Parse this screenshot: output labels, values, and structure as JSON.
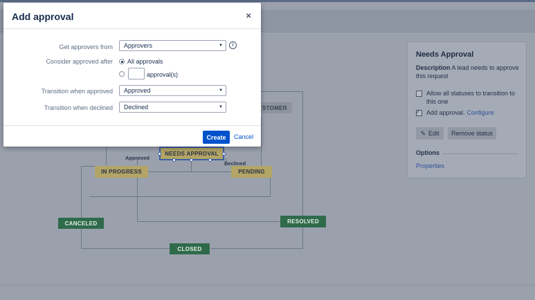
{
  "workflow": {
    "nodes": {
      "needs_approval": "NEEDS APPROVAL",
      "in_progress": "IN PROGRESS",
      "pending": "PENDING",
      "customer": "STOMER",
      "canceled": "CANCELED",
      "resolved": "RESOLVED",
      "closed": "CLOSED"
    },
    "labels": {
      "approved": "Approved",
      "declined": "Declined"
    }
  },
  "panel": {
    "title": "Needs Approval",
    "description_label": "Description",
    "description_text": "A lead needs to approve this request",
    "allow_all_statuses": "Allow all statuses to transition to this one",
    "add_approval": "Add approval.",
    "configure_link": "Configure",
    "edit_button": "Edit",
    "remove_button": "Remove status",
    "options_heading": "Options",
    "properties_link": "Properties"
  },
  "dialog": {
    "title": "Add approval",
    "close_glyph": "×",
    "approvers_from_label": "Get approvers from",
    "approvers_from_value": "Approvers",
    "consider_approved_label": "Consider approved after",
    "all_approvals_label": "All approvals",
    "approvals_suffix": "approval(s)",
    "approvals_count_value": "",
    "transition_approved_label": "Transition when approved",
    "transition_approved_value": "Approved",
    "transition_declined_label": "Transition when declined",
    "transition_declined_value": "Declined",
    "create_button": "Create",
    "cancel_link": "Cancel",
    "info_glyph": "i"
  },
  "icons": {
    "edit_icon": "pencil-icon",
    "close_icon": "close-icon",
    "info_icon": "info-icon"
  },
  "colors": {
    "primary": "#0052cc",
    "status_yellow": "#b3a565",
    "status_green": "#2f6b4a"
  }
}
